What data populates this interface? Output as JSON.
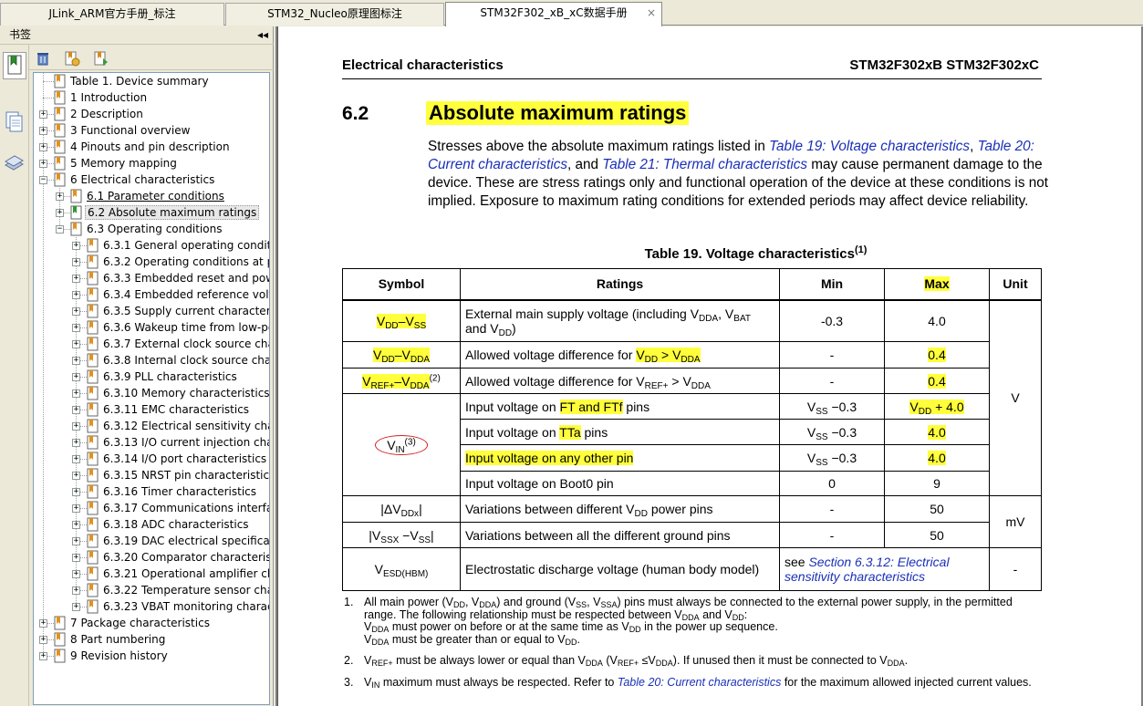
{
  "tabs": [
    {
      "label": "JLink_ARM官方手册_标注"
    },
    {
      "label": "STM32_Nucleo原理图标注"
    },
    {
      "label": "STM32F302_xB_xC数据手册",
      "active": true,
      "close": "×"
    }
  ],
  "panel": {
    "title": "书签",
    "collapse": "◂◂"
  },
  "bookmarks": [
    {
      "level": 0,
      "label": "Table 1. Device summary",
      "expand": ""
    },
    {
      "level": 0,
      "label": "1 Introduction",
      "expand": ""
    },
    {
      "level": 0,
      "label": "2 Description",
      "expand": "+"
    },
    {
      "level": 0,
      "label": "3 Functional overview",
      "expand": "+"
    },
    {
      "level": 0,
      "label": "4 Pinouts and pin description",
      "expand": "+"
    },
    {
      "level": 0,
      "label": "5 Memory mapping",
      "expand": "+"
    },
    {
      "level": 0,
      "label": "6 Electrical characteristics",
      "expand": "−"
    },
    {
      "level": 1,
      "label": "6.1 Parameter conditions",
      "expand": "+",
      "link": true
    },
    {
      "level": 1,
      "label": "6.2 Absolute maximum ratings",
      "expand": "+",
      "selected": true
    },
    {
      "level": 1,
      "label": "6.3 Operating conditions",
      "expand": "−"
    },
    {
      "level": 2,
      "label": "6.3.1 General operating conditions",
      "expand": "+"
    },
    {
      "level": 2,
      "label": "6.3.2 Operating conditions at power-up",
      "expand": "+"
    },
    {
      "level": 2,
      "label": "6.3.3 Embedded reset and power control",
      "expand": "+"
    },
    {
      "level": 2,
      "label": "6.3.4 Embedded reference voltage",
      "expand": "+"
    },
    {
      "level": 2,
      "label": "6.3.5 Supply current characteristics",
      "expand": "+"
    },
    {
      "level": 2,
      "label": "6.3.6 Wakeup time from low-power mode",
      "expand": "+"
    },
    {
      "level": 2,
      "label": "6.3.7 External clock source characteristics",
      "expand": "+"
    },
    {
      "level": 2,
      "label": "6.3.8 Internal clock source characteristics",
      "expand": "+"
    },
    {
      "level": 2,
      "label": "6.3.9 PLL characteristics",
      "expand": "+"
    },
    {
      "level": 2,
      "label": "6.3.10 Memory characteristics",
      "expand": "+"
    },
    {
      "level": 2,
      "label": "6.3.11 EMC characteristics",
      "expand": "+"
    },
    {
      "level": 2,
      "label": "6.3.12 Electrical sensitivity characteristics",
      "expand": "+"
    },
    {
      "level": 2,
      "label": "6.3.13 I/O current injection characteristics",
      "expand": "+"
    },
    {
      "level": 2,
      "label": "6.3.14 I/O port characteristics",
      "expand": "+"
    },
    {
      "level": 2,
      "label": "6.3.15 NRST pin characteristics",
      "expand": "+"
    },
    {
      "level": 2,
      "label": "6.3.16 Timer characteristics",
      "expand": "+"
    },
    {
      "level": 2,
      "label": "6.3.17 Communications interfaces",
      "expand": "+"
    },
    {
      "level": 2,
      "label": "6.3.18 ADC characteristics",
      "expand": "+"
    },
    {
      "level": 2,
      "label": "6.3.19 DAC electrical specifications",
      "expand": "+"
    },
    {
      "level": 2,
      "label": "6.3.20 Comparator characteristics",
      "expand": "+"
    },
    {
      "level": 2,
      "label": "6.3.21 Operational amplifier characteristics",
      "expand": "+"
    },
    {
      "level": 2,
      "label": "6.3.22 Temperature sensor characteristics",
      "expand": "+"
    },
    {
      "level": 2,
      "label": "6.3.23 VBAT monitoring characteristics",
      "expand": "+"
    },
    {
      "level": 0,
      "label": "7 Package characteristics",
      "expand": "+"
    },
    {
      "level": 0,
      "label": "8 Part numbering",
      "expand": "+"
    },
    {
      "level": 0,
      "label": "9 Revision history",
      "expand": "+"
    }
  ],
  "doc": {
    "header_left": "Electrical characteristics",
    "header_right": "STM32F302xB STM32F302xC",
    "section_number": "6.2",
    "section_title": "Absolute maximum ratings",
    "intro": {
      "t1": "Stresses above the absolute maximum ratings listed in ",
      "l1": "Table 19: Voltage characteristics",
      "t2": ", ",
      "l2": "Table 20: Current characteristics",
      "t3": ", and ",
      "l3": "Table 21: Thermal characteristics",
      "t4": " may cause permanent damage to the device. These are stress ratings only and functional operation of the device at these conditions is not implied. Exposure to maximum rating conditions for extended periods may affect device reliability."
    },
    "table_caption": "Table 19. Voltage characteristics",
    "table_caption_ref": "(1)",
    "table": {
      "headers": {
        "symbol": "Symbol",
        "ratings": "Ratings",
        "min": "Min",
        "max": "Max",
        "unit": "Unit"
      },
      "r1": {
        "rating_a": "External main supply voltage (including V",
        "rating_a_sub": "DDA",
        "rating_b": ", V",
        "rating_b_sub": "BAT",
        "rating_c": " and V",
        "rating_c_sub": "DD",
        "rating_d": ")",
        "min": "-0.3",
        "max": "4.0"
      },
      "r2": {
        "rating": "Allowed voltage difference for ",
        "min": "-",
        "max": "0.4"
      },
      "r3": {
        "rating_a": "Allowed voltage difference for V",
        "rating_a_sub": "REF+",
        "rating_b": " > V",
        "rating_b_sub": "DDA",
        "min": "-",
        "max": "0.4"
      },
      "r4": {
        "rating_a": "Input voltage on ",
        "rating_hl": "FT and FTf",
        "rating_b": " pins",
        "min_sym": "V",
        "min_sub": "SS",
        "min_val": " −0.3",
        "max_sym": "V",
        "max_sub": "DD",
        "max_val": " + 4.0"
      },
      "r5": {
        "rating_a": "Input voltage on ",
        "rating_hl": "TTa",
        "rating_b": " pins",
        "min_sym": "V",
        "min_sub": "SS",
        "min_val": " −0.3",
        "max": "4.0"
      },
      "r6": {
        "rating": "Input voltage on any other pin",
        "min_sym": "V",
        "min_sub": "SS",
        "min_val": " −0.3",
        "max": "4.0"
      },
      "r7": {
        "rating": "Input voltage on Boot0 pin",
        "min": "0",
        "max": "9"
      },
      "r8": {
        "rating_a": "Variations between different V",
        "rating_a_sub": "DD",
        "rating_b": " power pins",
        "min": "-",
        "max": "50"
      },
      "r9": {
        "rating": "Variations between all the different ground pins",
        "min": "-",
        "max": "50"
      },
      "r10": {
        "rating": "Electrostatic discharge voltage (human body model)",
        "see": "see ",
        "link": "Section 6.3.12: Electrical sensitivity characteristics",
        "unit": "-"
      },
      "unit_v": "V",
      "unit_mv": "mV"
    },
    "notes": {
      "n1_num": "1.",
      "n1_a": "All main power (V",
      "n1_b": ", V",
      "n1_c": ") and ground (V",
      "n1_d": ", V",
      "n1_e": ") pins must always be connected to the external power supply, in the permitted range. The following relationship must be respected between V",
      "n1_f": " and V",
      "n1_g": ":",
      "n1_h": " must power on before or at the same time as V",
      "n1_i": " in the power up sequence.",
      "n1_j": " must be greater than or equal to V",
      "n1_k": ".",
      "n2_num": "2.",
      "n2_a": " must be always lower or equal than V",
      "n2_b": " (V",
      "n2_c": " ≤V",
      "n2_d": "). If unused then it must be connected to V",
      "n2_e": ".",
      "n3_num": "3.",
      "n3_a": " maximum must always be respected. Refer to ",
      "n3_link": "Table 20: Current characteristics",
      "n3_b": " for the maximum allowed injected current values."
    }
  }
}
